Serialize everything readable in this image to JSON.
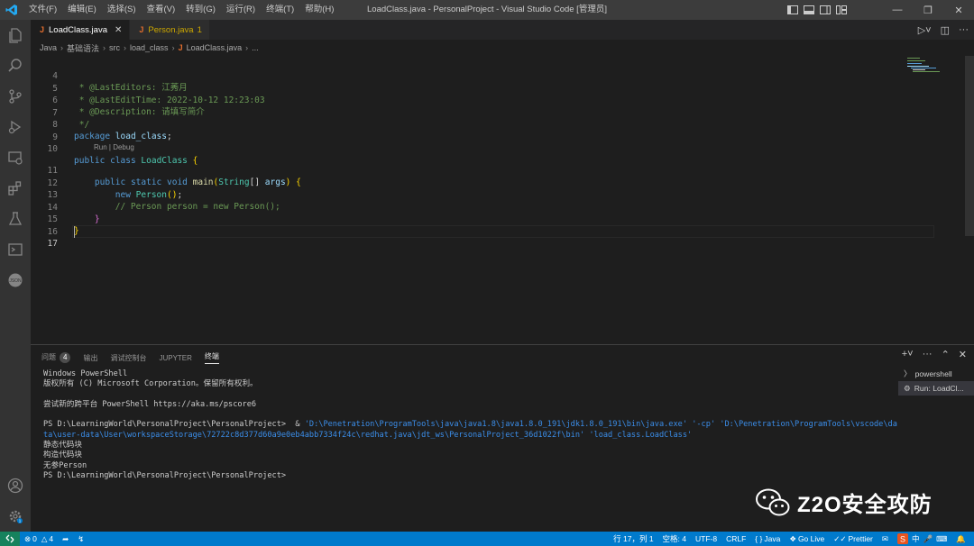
{
  "window": {
    "title": "LoadClass.java - PersonalProject - Visual Studio Code [管理员]",
    "menu": [
      "文件(F)",
      "编辑(E)",
      "选择(S)",
      "查看(V)",
      "转到(G)",
      "运行(R)",
      "终端(T)",
      "帮助(H)"
    ]
  },
  "tabs": [
    {
      "label": "LoadClass.java",
      "icon": "J",
      "active": true
    },
    {
      "label": "Person.java",
      "icon": "J",
      "badge": "1",
      "active": false
    }
  ],
  "breadcrumb": [
    "Java",
    "基础语法",
    "src",
    "load_class",
    "LoadClass.java",
    "..."
  ],
  "editor": {
    "lines": [
      {
        "n": "4",
        "text": " * @LastEditors: 江莠月"
      },
      {
        "n": "5",
        "text": " * @LastEditTime: 2022-10-12 12:23:03"
      },
      {
        "n": "6",
        "text": " * @Description: 请填写简介"
      },
      {
        "n": "7",
        "text": " */"
      },
      {
        "n": "8",
        "text": "package load_class;"
      },
      {
        "n": "9",
        "text": ""
      },
      {
        "n": "10",
        "text": "public class LoadClass {"
      },
      {
        "n": "11",
        "text": "    public static void main(String[] args) {"
      },
      {
        "n": "12",
        "text": "        new Person();"
      },
      {
        "n": "13",
        "text": "        // Person person = new Person();"
      },
      {
        "n": "14",
        "text": "    }"
      },
      {
        "n": "15",
        "text": "}"
      },
      {
        "n": "16",
        "text": ""
      },
      {
        "n": "17",
        "text": ""
      }
    ],
    "codelens": "Run | Debug"
  },
  "panel": {
    "tabs": [
      {
        "label": "问题",
        "badge": "4"
      },
      {
        "label": "输出"
      },
      {
        "label": "调试控制台"
      },
      {
        "label": "JUPYTER"
      },
      {
        "label": "终端",
        "active": true
      }
    ],
    "terminal_lines": [
      "Windows PowerShell",
      "版权所有 (C) Microsoft Corporation。保留所有权利。",
      "",
      "尝试新的跨平台 PowerShell https://aka.ms/pscore6",
      "",
      "PS D:\\LearningWorld\\PersonalProject\\PersonalProject>  & 'D:\\Penetration\\ProgramTools\\java\\java1.8\\java1.8.0_191\\jdk1.8.0_191\\bin\\java.exe' '-cp' 'D:\\Penetration\\ProgramTools\\vscode\\data\\user-data\\User\\workspaceStorage\\72722c8d377d60a9e0eb4abb7334f24c\\redhat.java\\jdt_ws\\PersonalProject_36d1022f\\bin' 'load_class.LoadClass'",
      "静态代码块",
      "构造代码块",
      "无参Person",
      "PS D:\\LearningWorld\\PersonalProject\\PersonalProject>"
    ],
    "terminal_list": [
      "powershell",
      "Run: LoadCl..."
    ]
  },
  "watermark": {
    "text": "Z2O安全攻防"
  },
  "statusbar": {
    "errors": "0",
    "warnings": "4",
    "position": "行 17，列 1",
    "indent": "空格: 4",
    "encoding": "UTF-8",
    "eol": "CRLF",
    "language": "Java",
    "golive": "Go Live",
    "prettier": "Prettier"
  },
  "colors": {
    "statusbar": "#007acc",
    "activitybar": "#333333",
    "titlebar": "#3c3c3c",
    "editor": "#1e1e1e"
  }
}
